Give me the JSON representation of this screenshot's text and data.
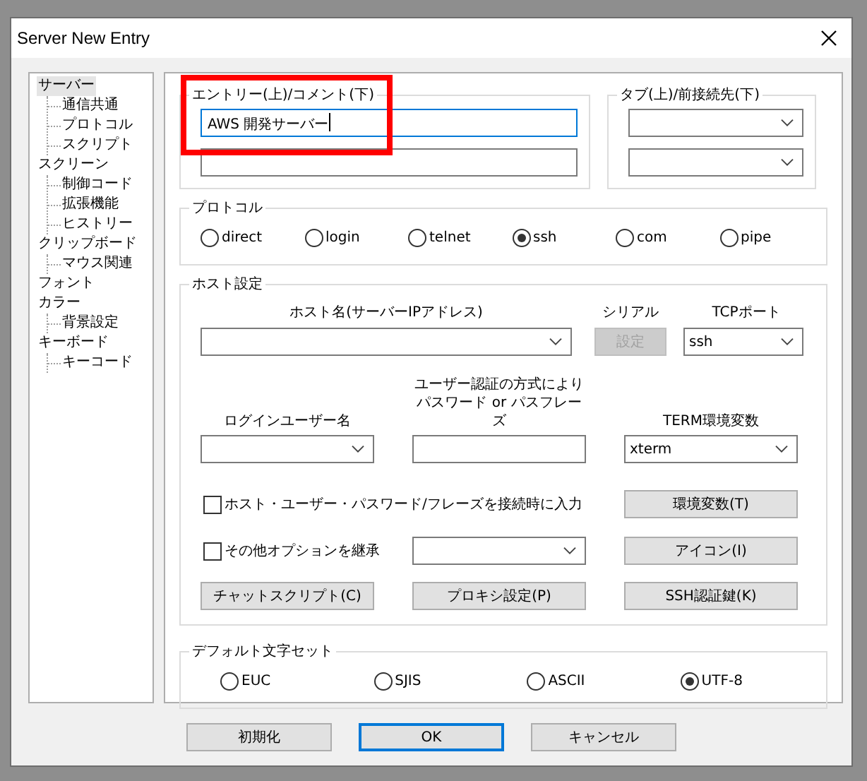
{
  "window": {
    "title": "Server New Entry"
  },
  "tree": [
    {
      "label": "サーバー",
      "selected": true,
      "children": [
        {
          "label": "通信共通",
          "selected": false
        },
        {
          "label": "プロトコル",
          "selected": false
        },
        {
          "label": "スクリプト",
          "selected": false
        }
      ]
    },
    {
      "label": "スクリーン",
      "selected": false,
      "children": [
        {
          "label": "制御コード",
          "selected": false
        },
        {
          "label": "拡張機能",
          "selected": false
        },
        {
          "label": "ヒストリー",
          "selected": false
        }
      ]
    },
    {
      "label": "クリップボード",
      "selected": false,
      "children": [
        {
          "label": "マウス関連",
          "selected": false
        }
      ]
    },
    {
      "label": "フォント",
      "selected": false
    },
    {
      "label": "カラー",
      "selected": false,
      "children": [
        {
          "label": "背景設定",
          "selected": false
        }
      ]
    },
    {
      "label": "キーボード",
      "selected": false,
      "children": [
        {
          "label": "キーコード",
          "selected": false
        }
      ]
    }
  ],
  "entry_group": {
    "legend": "エントリー(上)/コメント(下)",
    "highlighted": true,
    "entry": {
      "value": "AWS 開発サーバー",
      "focused": true
    }
  },
  "tab_group": {
    "legend": "タブ(上)/前接続先(下)"
  },
  "protocol": {
    "legend": "プロトコル",
    "options": [
      {
        "label": "direct",
        "selected": false
      },
      {
        "label": "login",
        "selected": false
      },
      {
        "label": "telnet",
        "selected": false
      },
      {
        "label": "ssh",
        "selected": true
      },
      {
        "label": "com",
        "selected": false
      },
      {
        "label": "pipe",
        "selected": false
      }
    ]
  },
  "host": {
    "legend": "ホスト設定",
    "host_label": "ホスト名(サーバーIPアドレス)",
    "serial_label": "シリアル",
    "serial_button": {
      "label": "設定",
      "disabled": true
    },
    "port_label": "TCPポート",
    "port": {
      "value": "ssh"
    },
    "user_label": "ログインユーザー名",
    "auth_label_lines": [
      "ユーザー認証の方式により",
      "パスワード or パスフレーズ"
    ],
    "term_label": "TERM環境変数",
    "term": {
      "value": "xterm"
    },
    "checkboxes": [
      {
        "label": "ホスト・ユーザー・パスワード/フレーズを接続時に入力",
        "checked": false
      },
      {
        "label": "その他オプションを継承",
        "checked": false
      }
    ],
    "env_button": "環境変数(T)",
    "icon_button": "アイコン(I)",
    "chat_button": "チャットスクリプト(C)",
    "proxy_button": "プロキシ設定(P)",
    "ssh_key_button": "SSH認証鍵(K)"
  },
  "charset": {
    "legend": "デフォルト文字セット",
    "options": [
      {
        "label": "EUC",
        "selected": false
      },
      {
        "label": "SJIS",
        "selected": false
      },
      {
        "label": "ASCII",
        "selected": false
      },
      {
        "label": "UTF-8",
        "selected": true
      }
    ]
  },
  "footer_buttons": [
    {
      "label": "初期化",
      "default": false
    },
    {
      "label": "OK",
      "default": true
    },
    {
      "label": "キャンセル",
      "default": false
    }
  ]
}
